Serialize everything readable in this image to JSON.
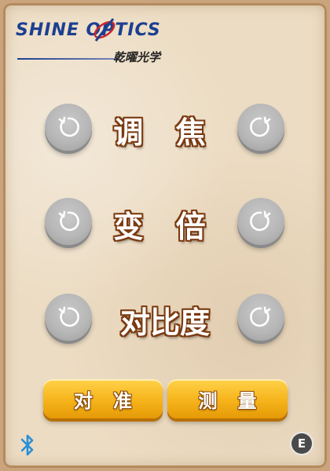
{
  "brand": {
    "wordmark": "SHINE OPTICS",
    "subtitle": "乾曜光学",
    "color": "#1c3f91"
  },
  "controls": [
    {
      "label": "调 焦",
      "left_icon": "rotate-ccw-icon",
      "right_icon": "rotate-cw-icon"
    },
    {
      "label": "变 倍",
      "left_icon": "rotate-ccw-icon",
      "right_icon": "rotate-cw-icon"
    },
    {
      "label": "对比度",
      "left_icon": "rotate-ccw-icon",
      "right_icon": "rotate-cw-icon"
    }
  ],
  "buttons": {
    "align_label": "对准",
    "measure_label": "测量"
  },
  "status": {
    "bluetooth_icon": "bluetooth-icon",
    "badge": "E"
  },
  "colors": {
    "button_yellow": "#f6b31a",
    "label_outline": "#7b3a10",
    "knob_gray": "#b7b7b7",
    "bluetooth_blue": "#2a8fd8"
  }
}
